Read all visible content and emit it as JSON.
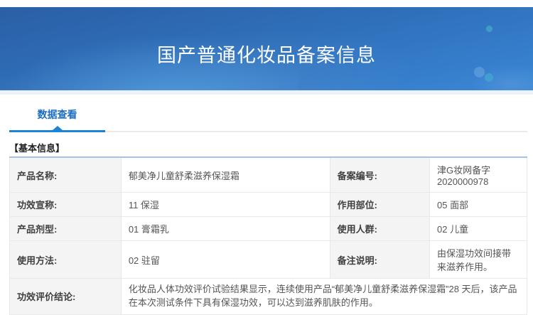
{
  "banner": {
    "title": "国产普通化妆品备案信息"
  },
  "tabs": {
    "active_label": "数据查看"
  },
  "section": {
    "heading": "【基本信息】"
  },
  "basic_info": {
    "rows": [
      {
        "label": "产品名称:",
        "value": "郁美净儿童舒柔滋养保湿霜",
        "label2": "备案编号:",
        "value2": "津G妆网备字2020000978"
      },
      {
        "label": "功效宣称:",
        "value": "11 保湿",
        "label2": "作用部位:",
        "value2": "05 面部"
      },
      {
        "label": "产品剂型:",
        "value": "01 膏霜乳",
        "label2": "使用人群:",
        "value2": "02 儿童"
      },
      {
        "label": "使用方法:",
        "value": "02 驻留",
        "label2": "备注说明:",
        "value2": "由保湿功效间接带来滋养作用。"
      }
    ],
    "conclusion_row": {
      "label": "功效评价结论:",
      "value": "化妆品人体功效评价试验结果显示，连续使用产品“郁美净儿童舒柔滋养保湿霜”28 天后，该产品在本次测试条件下具有保湿功效，可以达到滋养肌肤的作用。"
    }
  },
  "colors": {
    "banner_gradient_start": "#2b5fa5",
    "banner_gradient_end": "#3a87d6",
    "tab_active_text": "#1b6ec2",
    "tab_underline": "#1e83d3",
    "table_top_border": "#a9c3de",
    "label_cell_bg": "#f4f4f4",
    "cell_border": "#e9e9e9",
    "decor_dot_teal": "#48b0c6"
  }
}
